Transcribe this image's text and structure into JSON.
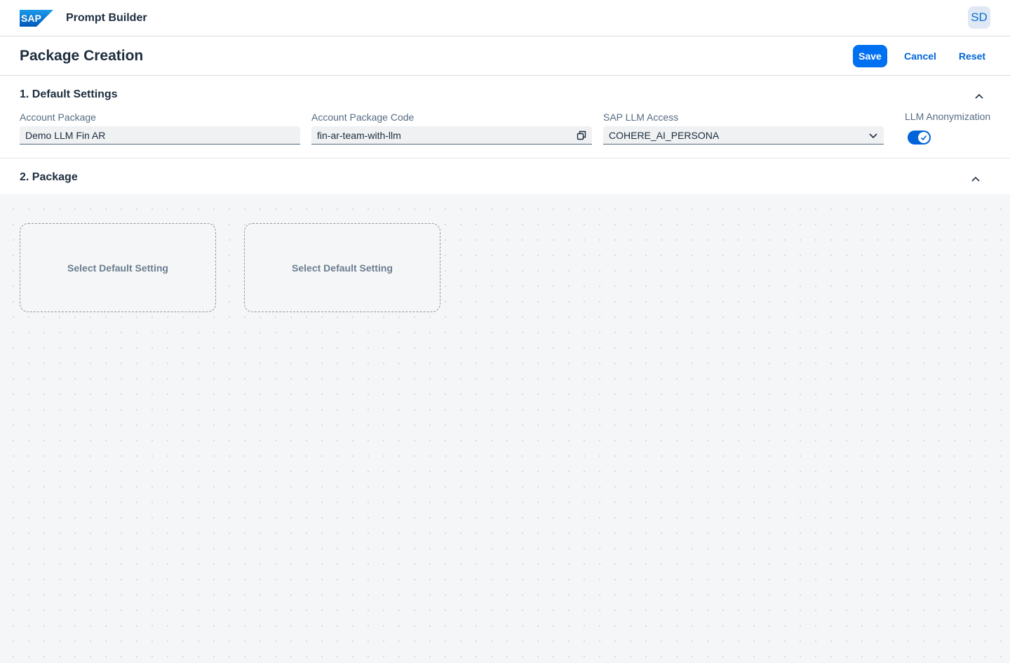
{
  "shell": {
    "logo_text": "SAP",
    "app_title": "Prompt Builder",
    "avatar_initials": "SD",
    "brand_color": "#0070f2"
  },
  "header": {
    "title": "Package Creation",
    "save_label": "Save",
    "cancel_label": "Cancel",
    "reset_label": "Reset"
  },
  "section1": {
    "title": "1. Default Settings",
    "collapse_icon": "chevron-up-icon",
    "fields": {
      "account_package": {
        "label": "Account Package",
        "value": "Demo LLM Fin AR"
      },
      "account_package_code": {
        "label": "Account Package Code",
        "value": "fin-ar-team-with-llm",
        "icon": "copy-icon"
      },
      "sap_llm_access": {
        "label": "SAP LLM Access",
        "value": "COHERE_AI_PERSONA",
        "icon": "chevron-down-icon"
      },
      "llm_anonymization": {
        "label": "LLM Anonymization",
        "enabled": true
      }
    }
  },
  "section2": {
    "title": "2. Package",
    "collapse_icon": "chevron-up-icon",
    "cards": [
      {
        "label": "Select Default Setting"
      },
      {
        "label": "Select Default Setting"
      }
    ]
  }
}
